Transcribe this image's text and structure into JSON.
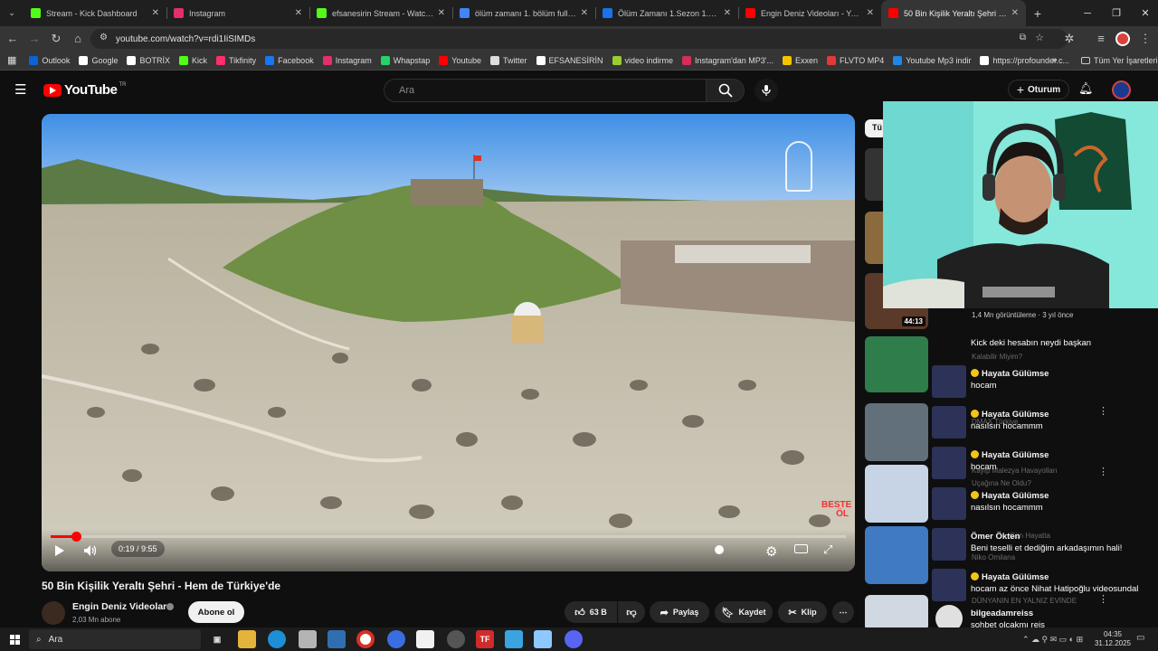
{
  "browser": {
    "tabs": [
      {
        "label": "Stream - Kick Dashboard",
        "color": "#53fc18"
      },
      {
        "label": "Instagram",
        "color": "#e1306c"
      },
      {
        "label": "efsanesirin Stream - Watch Live",
        "color": "#53fc18"
      },
      {
        "label": "ölüm zamanı 1. bölüm full izle",
        "color": "#4285f4"
      },
      {
        "label": "Ölüm Zamanı 1.Sezon 1.Bölüm",
        "color": "#1a73e8"
      },
      {
        "label": "Engin Deniz Videoları - YouTube",
        "color": "#ff0000"
      },
      {
        "label": "50 Bin Kişilik Yeraltı Şehri - Hem",
        "color": "#ff0000"
      }
    ],
    "url": "youtube.com/watch?v=rdi1IiSIMDs",
    "bookmarks": [
      {
        "label": "Outlook",
        "color": "#0a64d6"
      },
      {
        "label": "Google",
        "color": "#ffffff"
      },
      {
        "label": "BOTRİX",
        "color": "#ffffff"
      },
      {
        "label": "Kick",
        "color": "#53fc18"
      },
      {
        "label": "Tikfinity",
        "color": "#ff2d6e"
      },
      {
        "label": "Facebook",
        "color": "#1877f2"
      },
      {
        "label": "Instagram",
        "color": "#e1306c"
      },
      {
        "label": "Whapstap",
        "color": "#25d366"
      },
      {
        "label": "Youtube",
        "color": "#ff0000"
      },
      {
        "label": "Twitter",
        "color": "#dddddd"
      },
      {
        "label": "EFSANESİRİN",
        "color": "#ffffff"
      },
      {
        "label": "video indirme",
        "color": "#9acd32"
      },
      {
        "label": "Instagram'dan MP3'...",
        "color": "#d62d5a"
      },
      {
        "label": "Exxen",
        "color": "#f5c400"
      },
      {
        "label": "FLVTO MP4",
        "color": "#e53935"
      },
      {
        "label": "Youtube Mp3 indir",
        "color": "#1e88e5"
      },
      {
        "label": "https://profounder.c...",
        "color": "#ffffff"
      }
    ],
    "all_bookmarks": "Tüm Yer İşaretleri"
  },
  "youtube": {
    "logo": "YouTube",
    "region": "TR",
    "search_placeholder": "Ara",
    "signin_label": "Oturum",
    "video": {
      "time": "0:19 / 9:55",
      "progress_fraction": 0.032,
      "watermark": "BESTE ÖL",
      "title": "50 Bin Kişilik Yeraltı Şehri - Hem de Türkiye'de",
      "channel": "Engin Deniz Videoları",
      "subscribers": "2,03 Mn abone",
      "subscribe_label": "Abone ol",
      "likes": "63 B",
      "share": "Paylaş",
      "save": "Kaydet",
      "clip": "Klip"
    },
    "sidebar_chip": "Tü",
    "sidebar_meta": "1,4 Mn görüntüleme · 3 yıl önce",
    "sidebar_duration": "44:13"
  },
  "overlay": {
    "chat": [
      {
        "user": "",
        "text": "Kick deki hesabın neydi başkan",
        "emoji": false
      },
      {
        "user": "Hayata Gülümse",
        "text": "hocam",
        "emoji": true
      },
      {
        "user": "Hayata Gülümse",
        "text": "nasılsın hocammm",
        "emoji": true
      },
      {
        "user": "Hayata Gülümse",
        "text": "hocam",
        "emoji": true
      },
      {
        "user": "Hayata Gülümse",
        "text": "nasılsın hocammm",
        "emoji": true
      },
      {
        "user": "Ömer Ökten",
        "text": "Beni teselli et dediğim arkadaşımın hali!",
        "emoji": false
      },
      {
        "user": "Hayata Gülümse",
        "text": "hocam az önce Nihat Hatipoğlu videosundal",
        "emoji": true
      },
      {
        "user": "bilgeadamreiss",
        "text": "sohbet olcakmı reis",
        "emoji": false
      }
    ],
    "ghost_text": [
      "Kalabilir Miyim?",
      "DMAX Türkiye",
      "Kayıp Malezya Havayolları",
      "Uçağına Ne Oldu?",
      "Niko Omilana",
      "DÜNYANIN EN YALNIZ EVİNDE",
      "Gün Hayatta"
    ]
  },
  "taskbar": {
    "search": "Ara",
    "time": "04:35",
    "date": "31.12.2025"
  }
}
